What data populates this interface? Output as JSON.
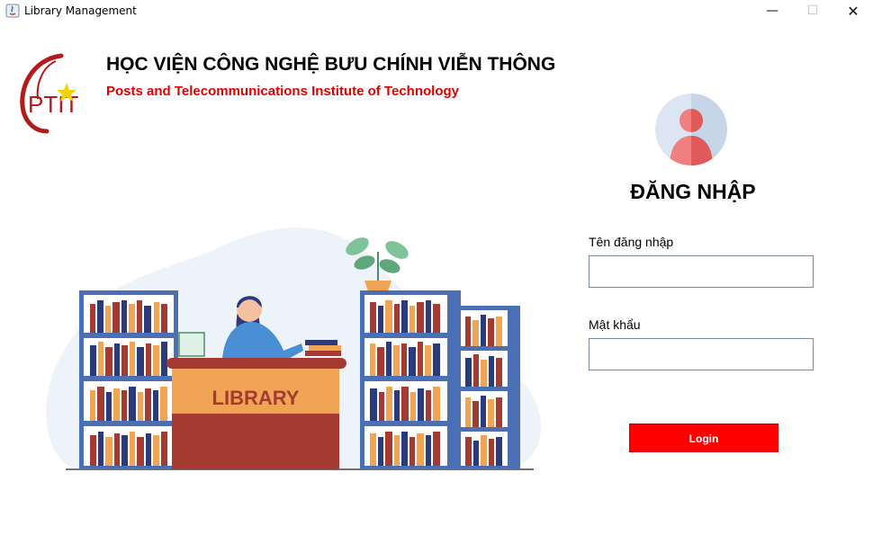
{
  "window": {
    "title": "Library Management",
    "minimize_glyph": "—",
    "maximize_glyph": "☐",
    "close_glyph": "✕"
  },
  "header": {
    "logo_text": "PTIT",
    "institute_vn": "HỌC VIỆN CÔNG NGHỆ BƯU CHÍNH VIỄN THÔNG",
    "institute_en": "Posts and Telecommunications Institute of Technology"
  },
  "illustration": {
    "desk_sign": "LIBRARY"
  },
  "login": {
    "title": "ĐĂNG NHẬP",
    "username_label": "Tên đăng nhập",
    "username_value": "",
    "password_label": "Mật khẩu",
    "password_value": "",
    "button_label": "Login"
  },
  "colors": {
    "brand_red": "#ff0000",
    "institute_en_red": "#e00000",
    "shelf_blue": "#4a6fb5",
    "desk_red": "#a53a33",
    "desk_orange": "#f2a455"
  }
}
